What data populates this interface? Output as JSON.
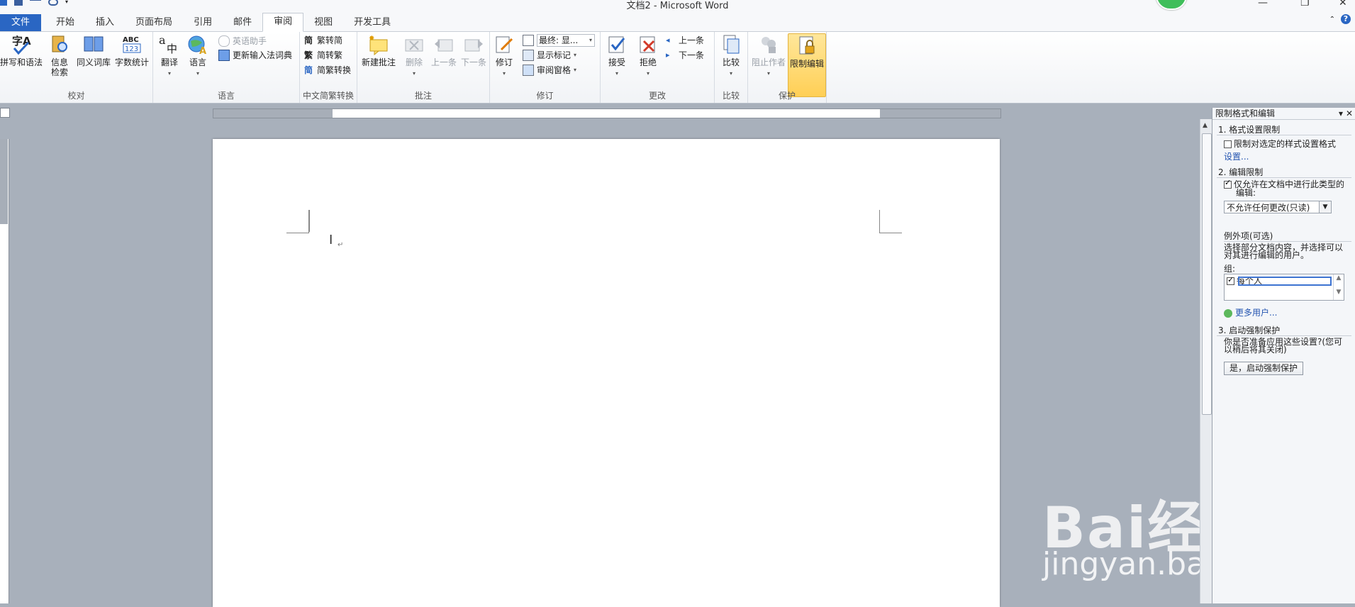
{
  "app": {
    "title": "文档2 - Microsoft Word"
  },
  "tabs": [
    {
      "label": "文件"
    },
    {
      "label": "开始"
    },
    {
      "label": "插入"
    },
    {
      "label": "页面布局"
    },
    {
      "label": "引用"
    },
    {
      "label": "邮件"
    },
    {
      "label": "审阅"
    },
    {
      "label": "视图"
    },
    {
      "label": "开发工具"
    }
  ],
  "ribbon": {
    "proofing": {
      "label": "校对",
      "spell": "拼写和语法",
      "research_1": "信息",
      "research_2": "检索",
      "thesaurus": "同义词库",
      "wordcount": "字数统计"
    },
    "language": {
      "label": "语言",
      "translate": "翻译",
      "language": "语言",
      "english_assistant": "英语助手",
      "update_ime": "更新输入法词典"
    },
    "chinese": {
      "label": "中文简繁转换",
      "t2s": "繁转简",
      "s2t": "简转繁",
      "convert": "简繁转换"
    },
    "comments": {
      "label": "批注",
      "new": "新建批注",
      "delete": "删除",
      "prev": "上一条",
      "next": "下一条"
    },
    "tracking": {
      "label": "修订",
      "track": "修订",
      "display": "最终: 显...",
      "show_markup": "显示标记",
      "reviewing_pane": "审阅窗格"
    },
    "changes": {
      "label": "更改",
      "accept": "接受",
      "reject": "拒绝",
      "prev": "上一条",
      "next": "下一条"
    },
    "compare": {
      "label": "比较",
      "compare": "比较"
    },
    "protect": {
      "label": "保护",
      "block_authors": "阻止作者",
      "restrict": "限制编辑"
    }
  },
  "pane": {
    "title": "限制格式和编辑",
    "s1_title": "1. 格式设置限制",
    "s1_check": "限制对选定的样式设置格式",
    "s1_link": "设置...",
    "s2_title": "2. 编辑限制",
    "s2_check_1": "仅允许在文档中进行此类型的",
    "s2_check_2": "编辑:",
    "s2_select": "不允许任何更改(只读)",
    "exceptions_title": "例外项(可选)",
    "exceptions_desc_1": "选择部分文档内容，并选择可以",
    "exceptions_desc_2": "对其进行编辑的用户。",
    "groups_label": "组:",
    "group_item": "每个人",
    "more_users": "更多用户...",
    "s3_title": "3. 启动强制保护",
    "s3_desc_1": "你是否准备应用这些设置?(您可",
    "s3_desc_2": "以稍后将其关闭)",
    "s3_button": "是，启动强制保护"
  },
  "watermark": {
    "brand": "Bai经验",
    "url": "jingyan.baidu.com"
  },
  "colors": {
    "accent": "#2a66c3",
    "highlight": "#ffd866",
    "avatar": "#3fbe5a"
  }
}
